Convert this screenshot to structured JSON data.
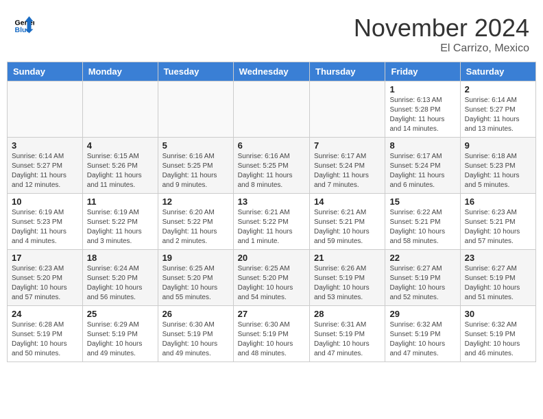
{
  "header": {
    "logo_line1": "General",
    "logo_line2": "Blue",
    "month": "November 2024",
    "location": "El Carrizo, Mexico"
  },
  "days_of_week": [
    "Sunday",
    "Monday",
    "Tuesday",
    "Wednesday",
    "Thursday",
    "Friday",
    "Saturday"
  ],
  "weeks": [
    [
      {
        "day": "",
        "info": ""
      },
      {
        "day": "",
        "info": ""
      },
      {
        "day": "",
        "info": ""
      },
      {
        "day": "",
        "info": ""
      },
      {
        "day": "",
        "info": ""
      },
      {
        "day": "1",
        "info": "Sunrise: 6:13 AM\nSunset: 5:28 PM\nDaylight: 11 hours and 14 minutes."
      },
      {
        "day": "2",
        "info": "Sunrise: 6:14 AM\nSunset: 5:27 PM\nDaylight: 11 hours and 13 minutes."
      }
    ],
    [
      {
        "day": "3",
        "info": "Sunrise: 6:14 AM\nSunset: 5:27 PM\nDaylight: 11 hours and 12 minutes."
      },
      {
        "day": "4",
        "info": "Sunrise: 6:15 AM\nSunset: 5:26 PM\nDaylight: 11 hours and 11 minutes."
      },
      {
        "day": "5",
        "info": "Sunrise: 6:16 AM\nSunset: 5:25 PM\nDaylight: 11 hours and 9 minutes."
      },
      {
        "day": "6",
        "info": "Sunrise: 6:16 AM\nSunset: 5:25 PM\nDaylight: 11 hours and 8 minutes."
      },
      {
        "day": "7",
        "info": "Sunrise: 6:17 AM\nSunset: 5:24 PM\nDaylight: 11 hours and 7 minutes."
      },
      {
        "day": "8",
        "info": "Sunrise: 6:17 AM\nSunset: 5:24 PM\nDaylight: 11 hours and 6 minutes."
      },
      {
        "day": "9",
        "info": "Sunrise: 6:18 AM\nSunset: 5:23 PM\nDaylight: 11 hours and 5 minutes."
      }
    ],
    [
      {
        "day": "10",
        "info": "Sunrise: 6:19 AM\nSunset: 5:23 PM\nDaylight: 11 hours and 4 minutes."
      },
      {
        "day": "11",
        "info": "Sunrise: 6:19 AM\nSunset: 5:22 PM\nDaylight: 11 hours and 3 minutes."
      },
      {
        "day": "12",
        "info": "Sunrise: 6:20 AM\nSunset: 5:22 PM\nDaylight: 11 hours and 2 minutes."
      },
      {
        "day": "13",
        "info": "Sunrise: 6:21 AM\nSunset: 5:22 PM\nDaylight: 11 hours and 1 minute."
      },
      {
        "day": "14",
        "info": "Sunrise: 6:21 AM\nSunset: 5:21 PM\nDaylight: 10 hours and 59 minutes."
      },
      {
        "day": "15",
        "info": "Sunrise: 6:22 AM\nSunset: 5:21 PM\nDaylight: 10 hours and 58 minutes."
      },
      {
        "day": "16",
        "info": "Sunrise: 6:23 AM\nSunset: 5:21 PM\nDaylight: 10 hours and 57 minutes."
      }
    ],
    [
      {
        "day": "17",
        "info": "Sunrise: 6:23 AM\nSunset: 5:20 PM\nDaylight: 10 hours and 57 minutes."
      },
      {
        "day": "18",
        "info": "Sunrise: 6:24 AM\nSunset: 5:20 PM\nDaylight: 10 hours and 56 minutes."
      },
      {
        "day": "19",
        "info": "Sunrise: 6:25 AM\nSunset: 5:20 PM\nDaylight: 10 hours and 55 minutes."
      },
      {
        "day": "20",
        "info": "Sunrise: 6:25 AM\nSunset: 5:20 PM\nDaylight: 10 hours and 54 minutes."
      },
      {
        "day": "21",
        "info": "Sunrise: 6:26 AM\nSunset: 5:19 PM\nDaylight: 10 hours and 53 minutes."
      },
      {
        "day": "22",
        "info": "Sunrise: 6:27 AM\nSunset: 5:19 PM\nDaylight: 10 hours and 52 minutes."
      },
      {
        "day": "23",
        "info": "Sunrise: 6:27 AM\nSunset: 5:19 PM\nDaylight: 10 hours and 51 minutes."
      }
    ],
    [
      {
        "day": "24",
        "info": "Sunrise: 6:28 AM\nSunset: 5:19 PM\nDaylight: 10 hours and 50 minutes."
      },
      {
        "day": "25",
        "info": "Sunrise: 6:29 AM\nSunset: 5:19 PM\nDaylight: 10 hours and 49 minutes."
      },
      {
        "day": "26",
        "info": "Sunrise: 6:30 AM\nSunset: 5:19 PM\nDaylight: 10 hours and 49 minutes."
      },
      {
        "day": "27",
        "info": "Sunrise: 6:30 AM\nSunset: 5:19 PM\nDaylight: 10 hours and 48 minutes."
      },
      {
        "day": "28",
        "info": "Sunrise: 6:31 AM\nSunset: 5:19 PM\nDaylight: 10 hours and 47 minutes."
      },
      {
        "day": "29",
        "info": "Sunrise: 6:32 AM\nSunset: 5:19 PM\nDaylight: 10 hours and 47 minutes."
      },
      {
        "day": "30",
        "info": "Sunrise: 6:32 AM\nSunset: 5:19 PM\nDaylight: 10 hours and 46 minutes."
      }
    ]
  ]
}
